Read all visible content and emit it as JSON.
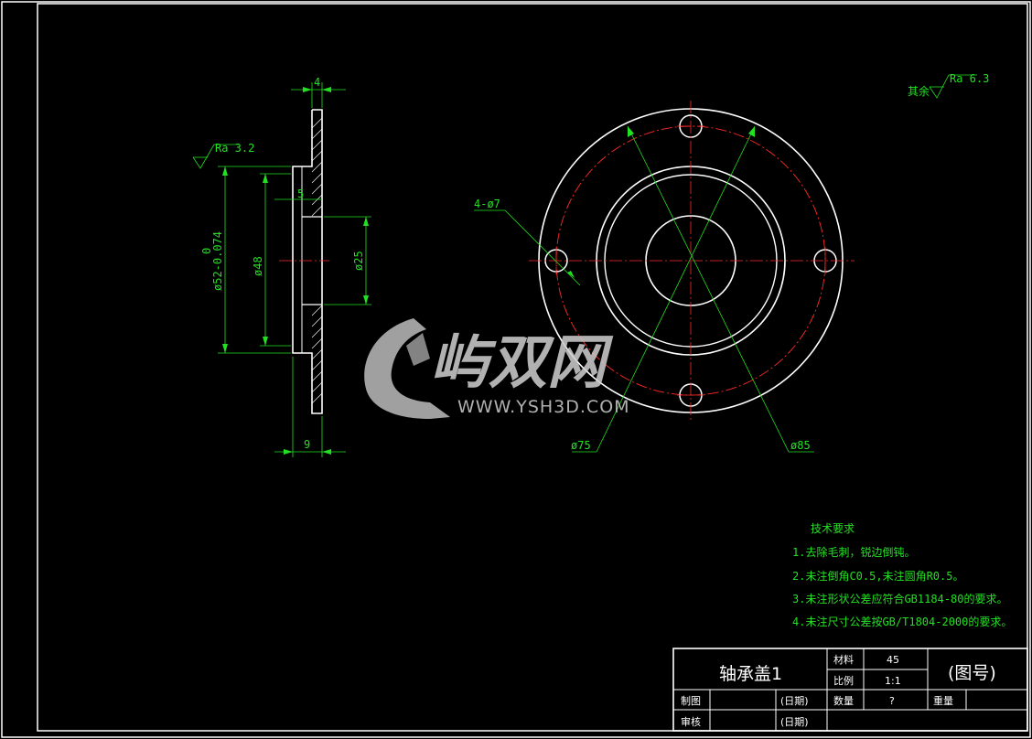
{
  "part_name": "轴承盖1",
  "drawing_no": "(图号)",
  "title_block": {
    "material_label": "材料",
    "material_value": "45",
    "scale_label": "比例",
    "scale_value": "1:1",
    "qty_label": "数量",
    "qty_value": "?",
    "weight_label": "重量",
    "drawn_label": "制图",
    "drawn_date": "(日期)",
    "checked_label": "审核",
    "checked_date": "(日期)"
  },
  "dimensions": {
    "top_width": "4",
    "step": "5",
    "bottom_width": "9",
    "dia_52": "ø52-0.074",
    "dia_52_upper": "0",
    "dia_48": "ø48",
    "dia_25": "ø25",
    "holes": "4-ø7",
    "dia_75": "ø75",
    "dia_85": "ø85"
  },
  "roughness": {
    "side": "Ra 3.2",
    "rest_label": "其余",
    "rest_value": "Ra 6.3"
  },
  "tech_requirements": {
    "title": "技术要求",
    "items": [
      "1.去除毛刺，锐边倒钝。",
      "2.未注倒角C0.5,未注圆角R0.5。",
      "3.未注形状公差应符合GB1184-80的要求。",
      "4.未注尺寸公差按GB/T1804-2000的要求。"
    ]
  },
  "watermark": {
    "brand": "屿双网",
    "url": "WWW.YSH3D.COM"
  }
}
